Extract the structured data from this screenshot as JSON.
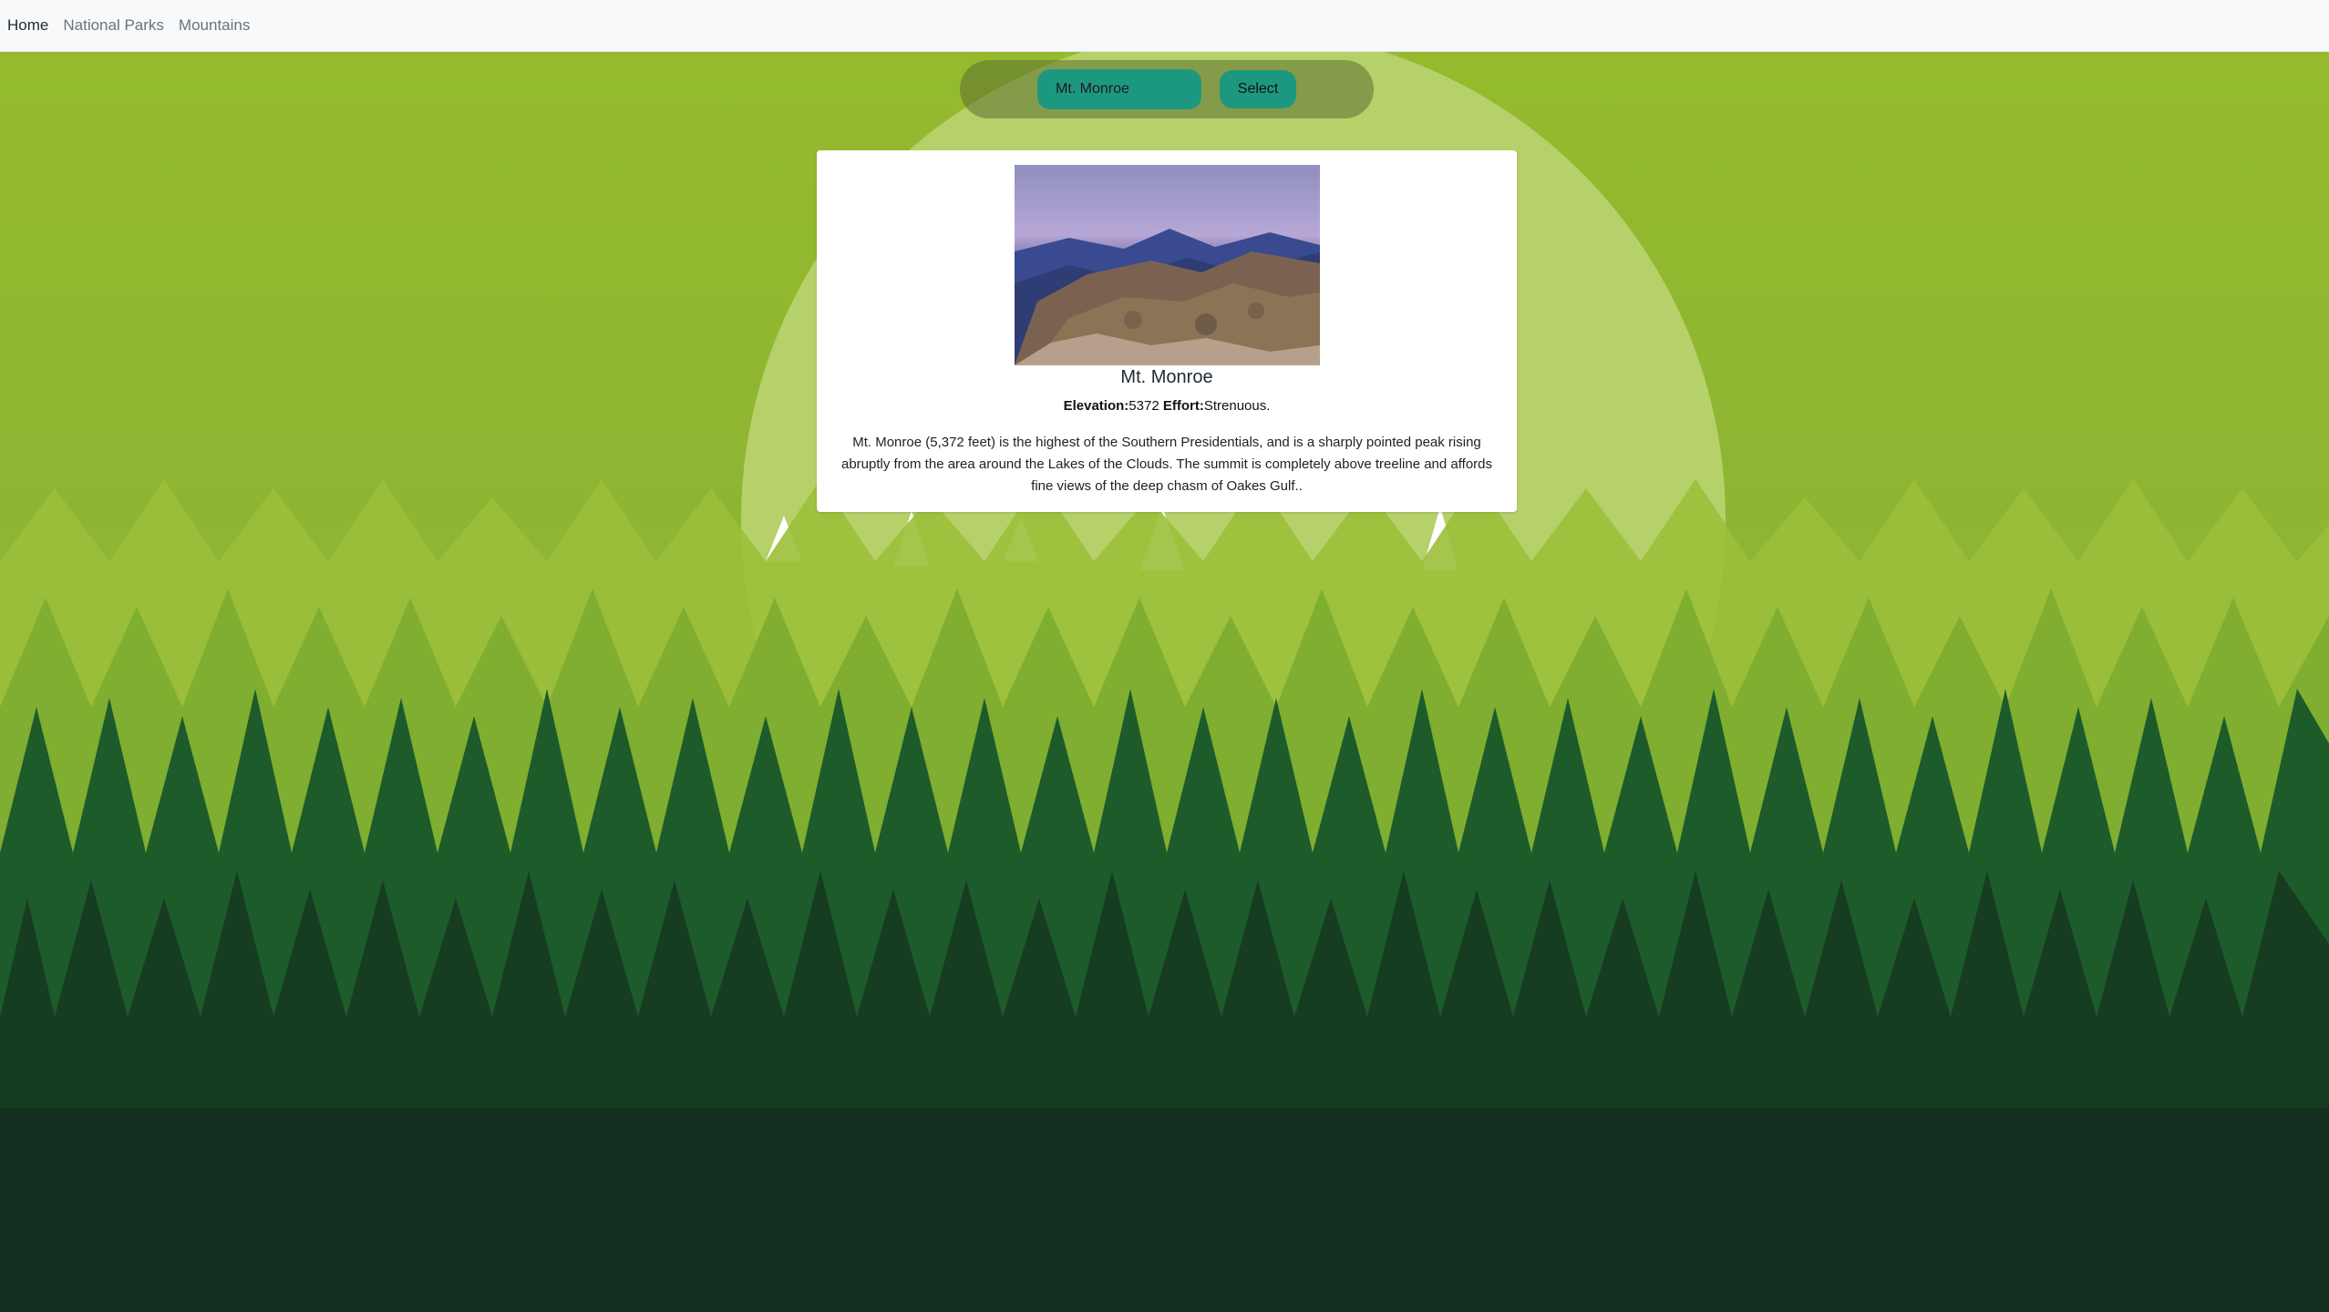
{
  "nav": {
    "items": [
      {
        "label": "Home",
        "active": true
      },
      {
        "label": "National Parks",
        "active": false
      },
      {
        "label": "Mountains",
        "active": false
      }
    ]
  },
  "controls": {
    "selected_mountain": "Mt. Monroe",
    "select_label": "Select"
  },
  "card": {
    "image_icon": "mountain-summit-photo",
    "title": "Mt. Monroe",
    "elevation_label": "Elevation:",
    "elevation_value": "5372",
    "effort_label": "Effort:",
    "effort_value": "Strenuous.",
    "description": "Mt. Monroe (5,372 feet) is the highest of the Southern Presidentials, and is a sharply pointed peak rising abruptly from the area around the Lakes of the Clouds. The summit is completely above treeline and affords fine views of the deep chasm of Oakes Gulf.."
  },
  "colors": {
    "sky_green": "#97bb2f",
    "sun": "#b8d26c",
    "forest_mid": "#1f5a2c",
    "forest_dark": "#132f1f",
    "button_teal": "#1d9880"
  }
}
